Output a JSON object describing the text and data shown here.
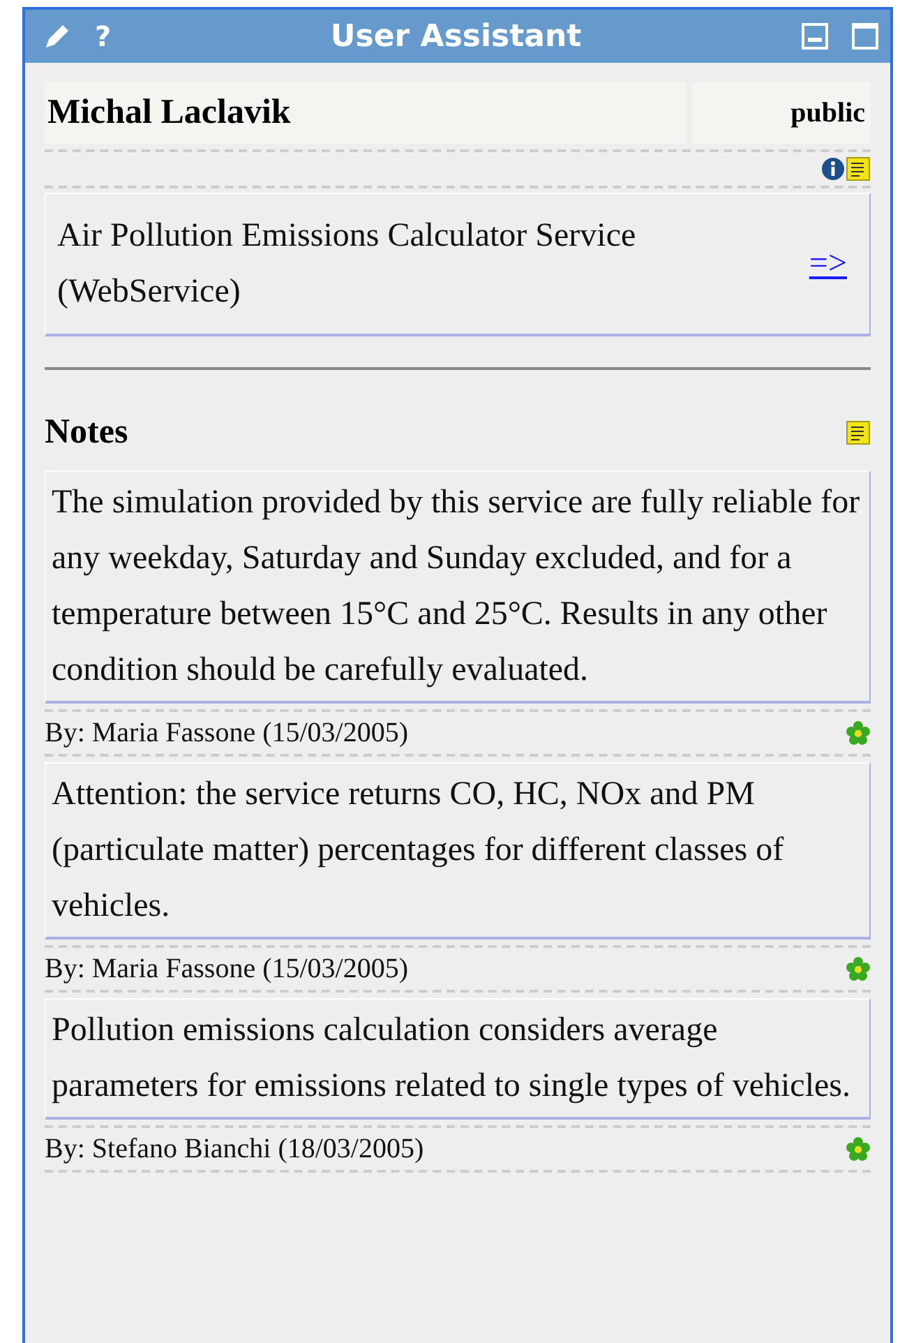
{
  "window": {
    "title": "User Assistant",
    "help": "?"
  },
  "user": {
    "name": "Michal Laclavik",
    "visibility": "public"
  },
  "service": {
    "text": "Air Pollution Emissions Calculator Service (WebService)",
    "link": "=>"
  },
  "notes": {
    "title": "Notes",
    "items": [
      {
        "text": "The simulation provided by this service are fully reliable for any weekday, Saturday and Sunday excluded, and for a temperature between 15°C and 25°C. Results in any other condition should be carefully evaluated.",
        "author": "By: Maria Fassone (15/03/2005)"
      },
      {
        "text": "Attention: the service returns CO, HC, NOx and PM (particulate matter) percentages for different classes of vehicles.",
        "author": "By: Maria Fassone (15/03/2005)"
      },
      {
        "text": "Pollution emissions calculation considers average parameters for emissions related to single types of vehicles.",
        "author": "By: Stefano Bianchi (18/03/2005)"
      }
    ]
  }
}
